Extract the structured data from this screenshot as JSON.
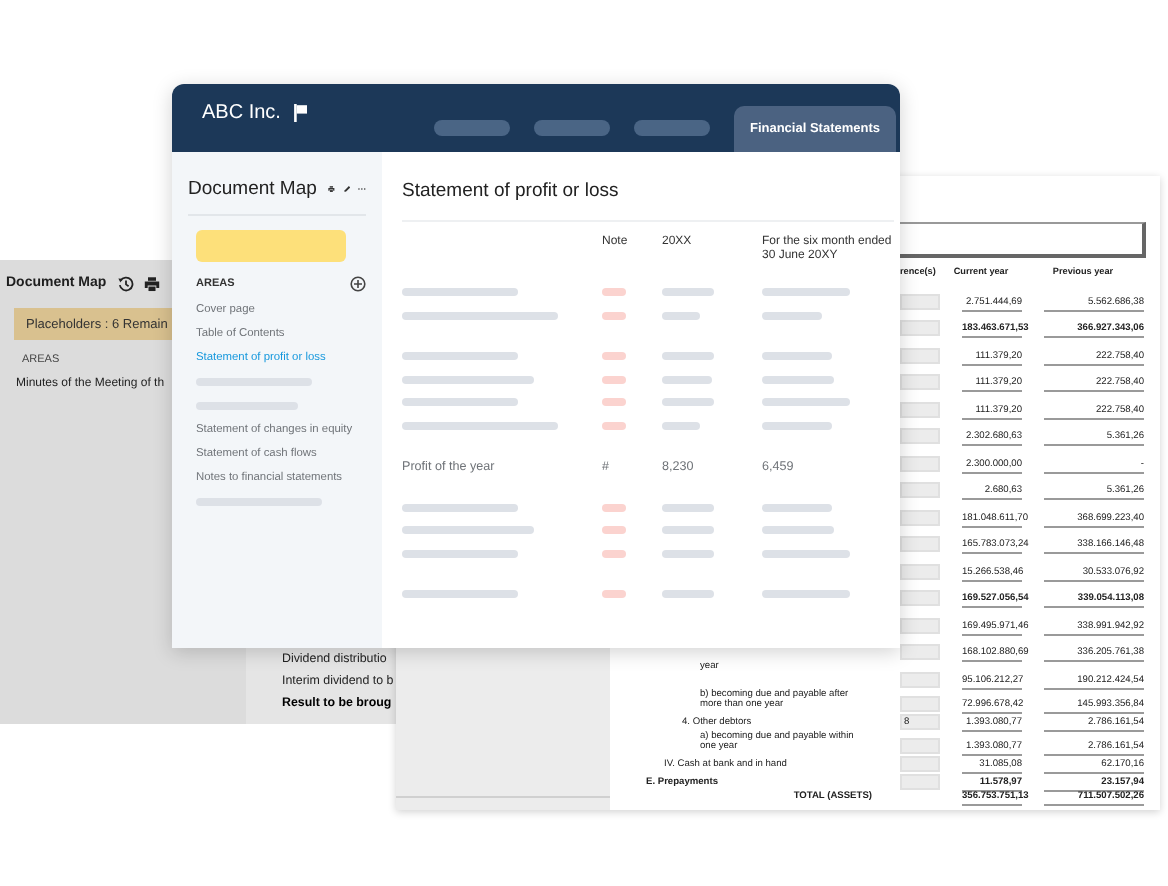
{
  "back_window": {
    "title": "Document Map",
    "banner": "Placeholders : 6 Remain",
    "section": "AREAS",
    "item": "Minutes of the Meeting of th",
    "document_lines": [
      {
        "text": "Dividend distributio",
        "bold": false
      },
      {
        "text": "Interim dividend to b",
        "bold": false
      },
      {
        "text": "Result to be broug",
        "bold": true
      }
    ]
  },
  "report_window": {
    "table": {
      "columns": [
        "rence(s)",
        "Current year",
        "Previous year"
      ],
      "rows": [
        {
          "kind": "value",
          "bold": false,
          "current": "2.751.444,69",
          "previous": "5.562.686,38"
        },
        {
          "kind": "value",
          "bold": true,
          "current": "183.463.671,53",
          "previous": "366.927.343,06"
        },
        {
          "kind": "value",
          "bold": false,
          "current": "111.379,20",
          "previous": "222.758,40"
        },
        {
          "kind": "value",
          "bold": false,
          "current": "111.379,20",
          "previous": "222.758,40"
        },
        {
          "kind": "value",
          "bold": false,
          "current": "111.379,20",
          "previous": "222.758,40"
        },
        {
          "kind": "value",
          "bold": false,
          "current": "2.302.680,63",
          "previous": "5.361,26"
        },
        {
          "kind": "value",
          "bold": false,
          "current": "2.300.000,00",
          "previous": "-"
        },
        {
          "kind": "value",
          "bold": false,
          "current": "2.680,63",
          "previous": "5.361,26"
        },
        {
          "kind": "value",
          "bold": false,
          "current": "181.048.611,70",
          "previous": "368.699.223,40"
        },
        {
          "kind": "value",
          "bold": false,
          "current": "165.783.073,24",
          "previous": "338.166.146,48"
        },
        {
          "kind": "value",
          "bold": false,
          "current": "15.266.538,46",
          "previous": "30.533.076,92"
        },
        {
          "kind": "value",
          "bold": true,
          "current": "169.527.056,54",
          "previous": "339.054.113,08"
        },
        {
          "kind": "value",
          "bold": false,
          "current": "169.495.971,46",
          "previous": "338.991.942,92"
        },
        {
          "kind": "value",
          "bold": false,
          "current": "168.102.880,69",
          "previous": "336.205.761,38"
        },
        {
          "kind": "sub",
          "bold": false,
          "label": "year",
          "current": "95.106.212,27",
          "previous": "190.212.424,54"
        },
        {
          "kind": "sub",
          "bold": false,
          "label": "b)  becoming due and payable after more than one year",
          "current": "72.996.678,42",
          "previous": "145.993.356,84"
        },
        {
          "kind": "item",
          "bold": false,
          "label": "4.  Other debtors",
          "input": "8",
          "current": "1.393.080,77",
          "previous": "2.786.161,54"
        },
        {
          "kind": "sub",
          "bold": false,
          "label": "a)  becoming due and payable within one year",
          "current": "1.393.080,77",
          "previous": "2.786.161,54"
        },
        {
          "kind": "group",
          "bold": false,
          "label": "IV.  Cash at bank and in hand",
          "current": "31.085,08",
          "previous": "62.170,16"
        },
        {
          "kind": "section",
          "bold": true,
          "label": "E.  Prepayments",
          "current": "11.578,97",
          "previous": "23.157,94"
        },
        {
          "kind": "total",
          "bold": true,
          "label": "TOTAL (ASSETS)",
          "current": "356.753.751,13",
          "previous": "711.507.502,26"
        }
      ]
    }
  },
  "main_window": {
    "title": "ABC Inc.",
    "tabs": [
      {
        "kind": "placeholder",
        "selected": false
      },
      {
        "kind": "placeholder",
        "selected": false
      },
      {
        "kind": "placeholder",
        "selected": false
      },
      {
        "kind": "tab",
        "label": "Financial Statements",
        "selected": true
      }
    ],
    "sidebar": {
      "title": "Document Map",
      "section": "AREAS",
      "items": [
        {
          "kind": "link",
          "label": "Cover page",
          "selected": false
        },
        {
          "kind": "link",
          "label": "Table of Contents",
          "selected": false
        },
        {
          "kind": "link",
          "label": "Statement of profit or loss",
          "selected": true
        },
        {
          "kind": "placeholder"
        },
        {
          "kind": "placeholder"
        },
        {
          "kind": "link",
          "label": "Statement of changes in equity",
          "selected": false
        },
        {
          "kind": "link",
          "label": "Statement of cash flows",
          "selected": false
        },
        {
          "kind": "link",
          "label": "Notes to financial statements",
          "selected": false
        },
        {
          "kind": "placeholder"
        }
      ]
    },
    "content": {
      "title": "Statement of profit or loss",
      "columns": [
        "Note",
        "20XX",
        "For the six month ended 30 June 20XY"
      ],
      "row_groups": [
        [
          {
            "kind": "placeholder"
          },
          {
            "kind": "placeholder"
          }
        ],
        [
          {
            "kind": "placeholder"
          },
          {
            "kind": "placeholder"
          },
          {
            "kind": "placeholder"
          },
          {
            "kind": "placeholder"
          }
        ],
        [
          {
            "kind": "row",
            "cells": [
              "Profit of the year",
              "#",
              "8,230",
              "6,459"
            ]
          }
        ],
        [
          {
            "kind": "placeholder"
          },
          {
            "kind": "placeholder"
          },
          {
            "kind": "placeholder"
          }
        ],
        [
          {
            "kind": "placeholder"
          }
        ]
      ]
    }
  }
}
